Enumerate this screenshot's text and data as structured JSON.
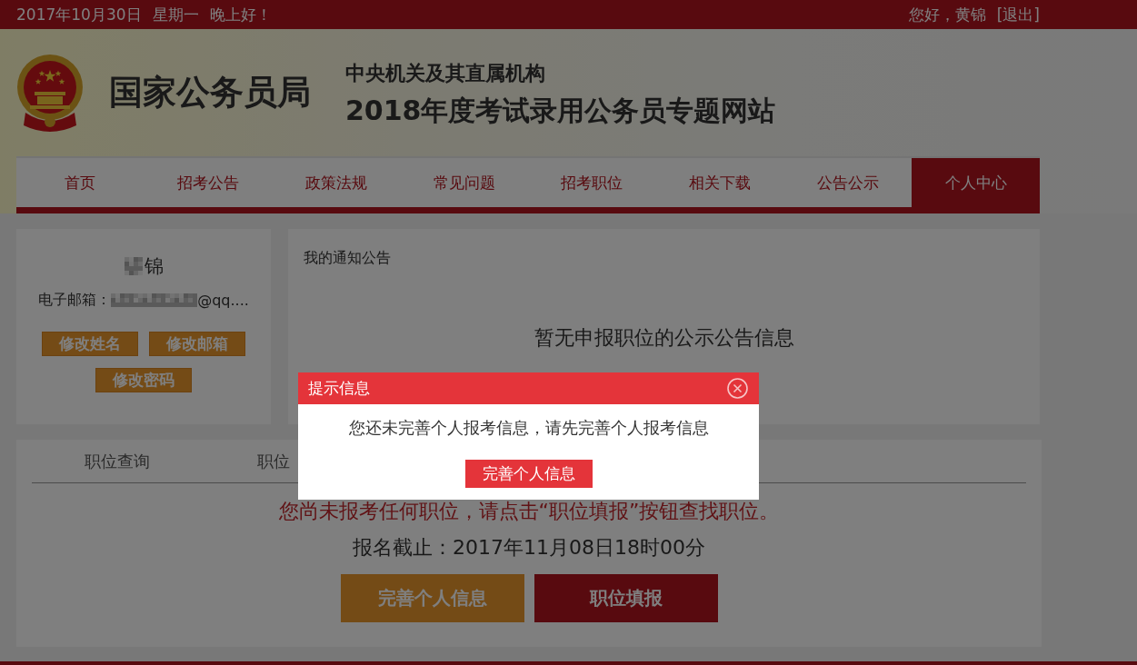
{
  "top_bar": {
    "date": "2017年10月30日",
    "weekday": "星期一",
    "greeting": "晚上好！",
    "user_greeting": "您好，黄锦",
    "logout_link": "[退出]"
  },
  "header": {
    "site_name": "国家公务员局",
    "subtitle": "中央机关及其直属机构",
    "title": "2018年度考试录用公务员专题网站"
  },
  "nav": [
    {
      "label": "首页",
      "selected": false
    },
    {
      "label": "招考公告",
      "selected": false
    },
    {
      "label": "政策法规",
      "selected": false
    },
    {
      "label": "常见问题",
      "selected": false
    },
    {
      "label": "招考职位",
      "selected": false
    },
    {
      "label": "相关下载",
      "selected": false
    },
    {
      "label": "公告公示",
      "selected": false
    },
    {
      "label": "个人中心",
      "selected": true
    }
  ],
  "profile_card": {
    "name": "锦",
    "email_label": "电子邮箱：",
    "email": "@qq....",
    "buttons": [
      "修改姓名",
      "修改邮箱",
      "修改密码"
    ]
  },
  "notice_card": {
    "title": "我的通知公告",
    "empty_message": "暂无申报职位的公示公告信息"
  },
  "positions_card": {
    "tabs": [
      "职位查询",
      "职位"
    ],
    "message": "您尚未报考任何职位，请点击“职位填报”按钮查找职位。",
    "deadline": "报名截止：2017年11月08日18时00分",
    "buttons": [
      {
        "label": "完善个人信息",
        "kind": "secondary"
      },
      {
        "label": "职位填报",
        "kind": "primary"
      }
    ]
  },
  "dialog": {
    "title": "提示信息",
    "message": "您还未完善个人报考信息，请先完善个人报考信息",
    "button": "完善个人信息"
  }
}
